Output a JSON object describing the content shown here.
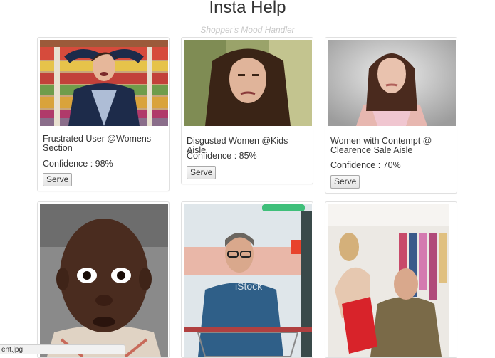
{
  "header": {
    "title": "Insta Help",
    "subtitle": "Shopper's Mood Handler"
  },
  "cards": [
    {
      "caption": "Frustrated User @Womens Section",
      "confidence": "Confidence : 98%",
      "button": "Serve"
    },
    {
      "caption": "Disgusted Women @Kids Aisle",
      "confidence": "Confidence : 85%",
      "button": "Serve"
    },
    {
      "caption": "Women with Contempt @ Clearence Sale Aisle",
      "confidence": "Confidence : 70%",
      "button": "Serve"
    },
    {
      "caption": "",
      "confidence": "",
      "button": ""
    },
    {
      "caption": "",
      "confidence": "",
      "button": ""
    },
    {
      "caption": "",
      "confidence": "",
      "button": ""
    }
  ],
  "status_bar": {
    "text": "ent.jpg"
  },
  "photo_watermark": "iStock"
}
